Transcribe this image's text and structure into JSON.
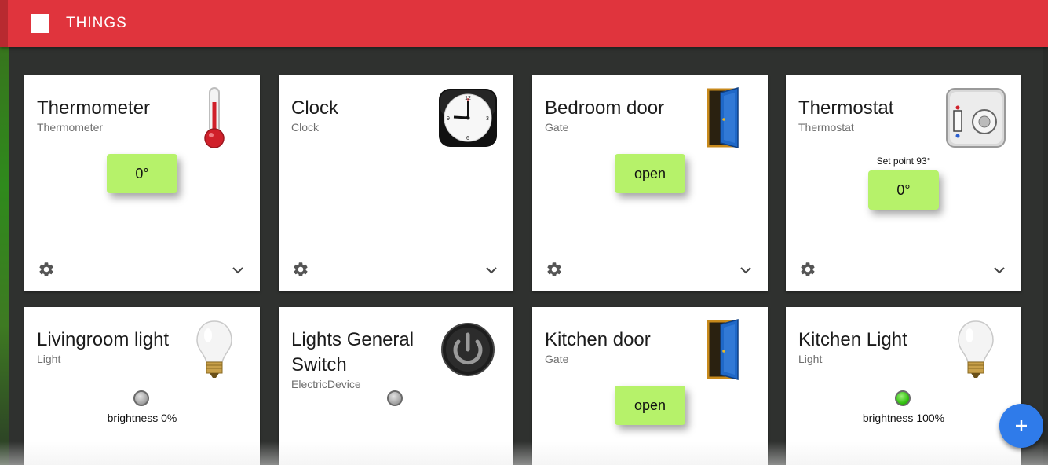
{
  "app": {
    "title": "THINGS"
  },
  "colors": {
    "topbar": "#e0343d",
    "value_button": "#b6f26a",
    "fab": "#2f7bea",
    "led_on": "#34c212",
    "led_off": "#a9a9a9"
  },
  "cards": [
    {
      "name": "Thermometer",
      "type": "Thermometer",
      "icon": "thermometer-icon",
      "value": "0°"
    },
    {
      "name": "Clock",
      "type": "Clock",
      "icon": "clock-icon"
    },
    {
      "name": "Bedroom door",
      "type": "Gate",
      "icon": "door-icon",
      "value": "open"
    },
    {
      "name": "Thermostat",
      "type": "Thermostat",
      "icon": "thermostat-icon",
      "setpoint": "Set point 93°",
      "value": "0°"
    },
    {
      "name": "Livingroom light",
      "type": "Light",
      "icon": "light-bulb-icon",
      "state": "off",
      "brightness": "brightness 0%"
    },
    {
      "name": "Lights General Switch",
      "type": "ElectricDevice",
      "icon": "power-icon",
      "state": "off"
    },
    {
      "name": "Kitchen door",
      "type": "Gate",
      "icon": "door-icon",
      "value": "open"
    },
    {
      "name": "Kitchen Light",
      "type": "Light",
      "icon": "light-bulb-icon",
      "state": "on",
      "brightness": "brightness 100%"
    }
  ],
  "card_actions": {
    "settings_icon": "gear-icon",
    "expand_icon": "chevron-down-icon"
  },
  "fab": {
    "icon": "plus-icon"
  }
}
